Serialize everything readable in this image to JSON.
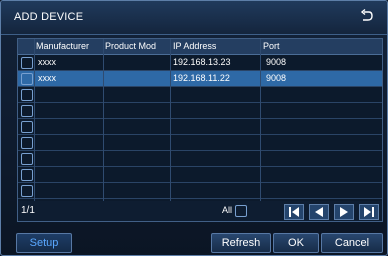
{
  "dialog": {
    "title": "ADD DEVICE",
    "back_icon": "return-arrow-icon"
  },
  "table": {
    "columns": [
      "Manufacturer",
      "Product Mod",
      "IP Address",
      "Port"
    ],
    "rows": [
      {
        "manufacturer": "xxxx",
        "product_model": "",
        "ip": "192.168.13.23",
        "port": "9008",
        "selected": false
      },
      {
        "manufacturer": "xxxx",
        "product_model": "",
        "ip": "192.168.11.22",
        "port": "9008",
        "selected": true
      }
    ],
    "empty_rows": 8
  },
  "footer": {
    "page": "1/1",
    "all_label": "All"
  },
  "buttons": {
    "setup": "Setup",
    "refresh": "Refresh",
    "ok": "OK",
    "cancel": "Cancel"
  },
  "colors": {
    "selected_row": "#2e69a6",
    "setup_text": "#5aa8ff"
  }
}
